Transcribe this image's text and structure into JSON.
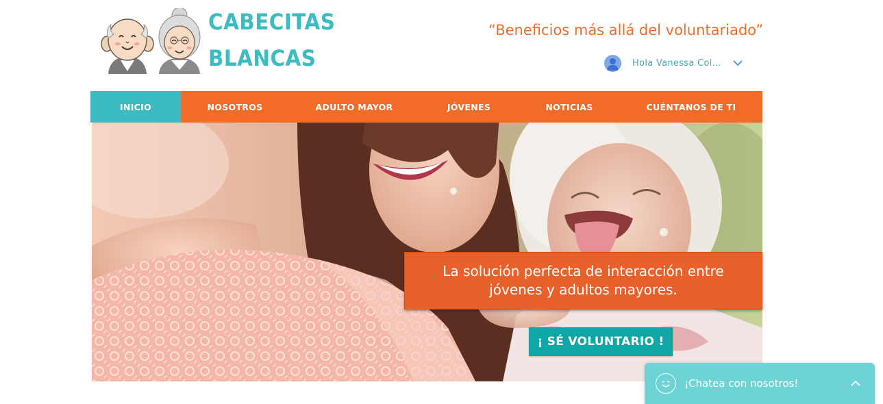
{
  "brand": {
    "logo_line1": "CABECITAS",
    "logo_line2": "BLANCAS",
    "tagline": "“Beneficios más allá del voluntariado”",
    "colors": {
      "teal": "#3cbcc0",
      "orange": "#f26b27"
    }
  },
  "user": {
    "greeting": "Hola Vanessa Colq...",
    "icons": [
      "user-avatar-icon",
      "chevron-down-icon"
    ]
  },
  "nav": {
    "items": [
      {
        "label": "INICIO",
        "active": true
      },
      {
        "label": "NOSOTROS",
        "active": false
      },
      {
        "label": "ADULTO MAYOR",
        "active": false
      },
      {
        "label": "JÓVENES",
        "active": false
      },
      {
        "label": "NOTICIAS",
        "active": false
      },
      {
        "label": "CUÉNTANOS DE TI",
        "active": false
      }
    ]
  },
  "hero": {
    "callout": "La solución perfecta de interacción entre jóvenes y adultos mayores.",
    "cta_label": "¡ SÉ VOLUNTARIO !",
    "colors": {
      "callout_bg": "#e8612a",
      "cta_bg": "#0fa6a6"
    }
  },
  "chat": {
    "label": "¡Chatea con nosotros!",
    "icons": [
      "smiley-icon",
      "chevron-up-icon"
    ],
    "color": "#6dd3d4"
  }
}
